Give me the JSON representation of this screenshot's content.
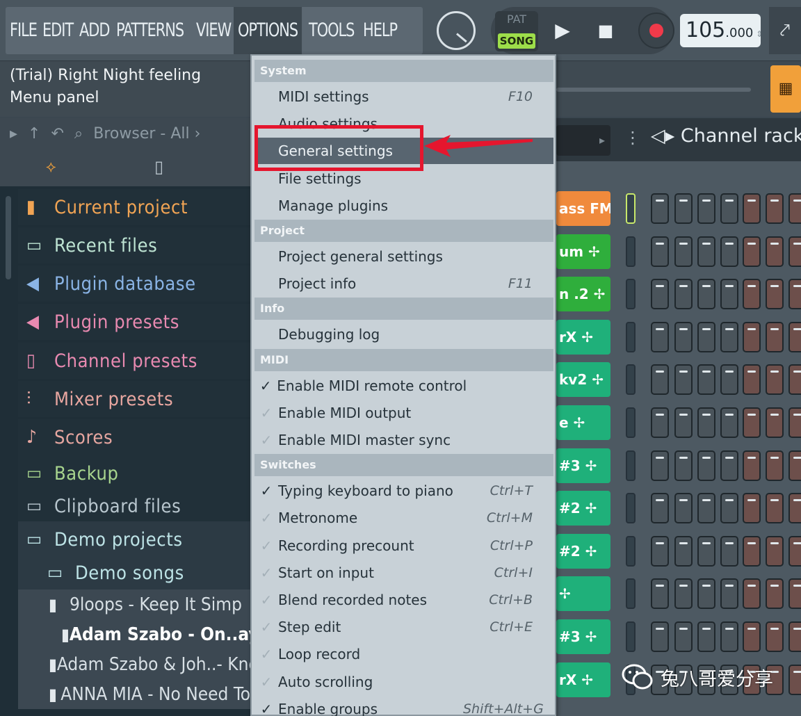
{
  "menubar": {
    "items": [
      "FILE",
      "EDIT",
      "ADD",
      "PATTERNS",
      "VIEW",
      "OPTIONS",
      "TOOLS",
      "HELP"
    ],
    "active": "OPTIONS"
  },
  "transport": {
    "pat": "PAT",
    "song": "SONG",
    "tempo": "105",
    "tempo_decimal": ".000"
  },
  "hint": {
    "line1": "(Trial) Right Night feeling",
    "line2": "Menu panel"
  },
  "browser": {
    "label": "Browser - All",
    "folders": [
      {
        "label": "Current project",
        "icon": "document-icon",
        "color": "#f1a454"
      },
      {
        "label": "Recent files",
        "icon": "folder-icon",
        "color": "#bde3d2"
      },
      {
        "label": "Plugin database",
        "icon": "speaker-icon",
        "color": "#8ab4e6"
      },
      {
        "label": "Plugin presets",
        "icon": "speaker-icon",
        "color": "#e98ab1"
      },
      {
        "label": "Channel presets",
        "icon": "channel-icon",
        "color": "#e98ab1"
      },
      {
        "label": "Mixer presets",
        "icon": "mixer-icon",
        "color": "#e8a6a0"
      },
      {
        "label": "Scores",
        "icon": "note-icon",
        "color": "#e6a6a0"
      },
      {
        "label": "Backup",
        "icon": "folder-icon",
        "color": "#a8d58e"
      },
      {
        "label": "Clipboard files",
        "icon": "folder-icon",
        "color": "#b8c6ce"
      },
      {
        "label": "Demo projects",
        "icon": "folder-icon",
        "color": "#bde3e6"
      },
      {
        "label": "Demo songs",
        "icon": "folder-icon",
        "color": "#bde3e6"
      }
    ],
    "files": [
      "9loops - Keep It Simp",
      "Adam Szabo - On..ay (",
      "Adam Szabo & Joh..- Knc",
      "ANNA MIA - No Need To"
    ]
  },
  "options_menu": {
    "sections": [
      {
        "title": "System",
        "items": [
          {
            "label": "MIDI settings",
            "shortcut": "F10",
            "check": ""
          },
          {
            "label": "Audio settings",
            "shortcut": "",
            "check": ""
          },
          {
            "label": "General settings",
            "shortcut": "",
            "check": "",
            "highlighted": true
          },
          {
            "label": "File settings",
            "shortcut": "",
            "check": ""
          },
          {
            "label": "Manage plugins",
            "shortcut": "",
            "check": ""
          }
        ]
      },
      {
        "title": "Project",
        "items": [
          {
            "label": "Project general settings",
            "shortcut": "",
            "check": ""
          },
          {
            "label": "Project info",
            "shortcut": "F11",
            "check": ""
          }
        ]
      },
      {
        "title": "Info",
        "items": [
          {
            "label": "Debugging log",
            "shortcut": "",
            "check": ""
          }
        ]
      },
      {
        "title": "MIDI",
        "items": [
          {
            "label": "Enable MIDI remote control",
            "shortcut": "",
            "check": "on"
          },
          {
            "label": "Enable MIDI output",
            "shortcut": "",
            "check": "dim"
          },
          {
            "label": "Enable MIDI master sync",
            "shortcut": "",
            "check": "dim"
          }
        ]
      },
      {
        "title": "Switches",
        "items": [
          {
            "label": "Typing keyboard to piano",
            "shortcut": "Ctrl+T",
            "check": "on"
          },
          {
            "label": "Metronome",
            "shortcut": "Ctrl+M",
            "check": "dim"
          },
          {
            "label": "Recording precount",
            "shortcut": "Ctrl+P",
            "check": "dim"
          },
          {
            "label": "Start on input",
            "shortcut": "Ctrl+I",
            "check": "dim"
          },
          {
            "label": "Blend recorded notes",
            "shortcut": "Ctrl+B",
            "check": "dim"
          },
          {
            "label": "Step edit",
            "shortcut": "Ctrl+E",
            "check": "dim"
          },
          {
            "label": "Loop record",
            "shortcut": "",
            "check": "dim"
          },
          {
            "label": "Auto scrolling",
            "shortcut": "",
            "check": "dim"
          },
          {
            "label": "Enable groups",
            "shortcut": "Shift+Alt+G",
            "check": "on"
          }
        ]
      }
    ]
  },
  "channel_rack": {
    "title": "Channel rack",
    "channels": [
      {
        "label": "ass FM",
        "color": "#f08a3c"
      },
      {
        "label": "um",
        "color": "#2fae3c"
      },
      {
        "label": "n .2",
        "color": "#2fae3c"
      },
      {
        "label": "rX",
        "color": "#1fb07a"
      },
      {
        "label": "kv2",
        "color": "#1fb07a"
      },
      {
        "label": "e",
        "color": "#1fb07a"
      },
      {
        "label": "#3",
        "color": "#1fb07a"
      },
      {
        "label": "#2",
        "color": "#1fb07a"
      },
      {
        "label": "#2",
        "color": "#1fb07a"
      },
      {
        "label": "",
        "color": "#1fb07a"
      },
      {
        "label": "#3",
        "color": "#1fb07a"
      },
      {
        "label": "rX",
        "color": "#1fb07a"
      }
    ]
  },
  "watermark": {
    "text": "兔八哥爱分享"
  }
}
